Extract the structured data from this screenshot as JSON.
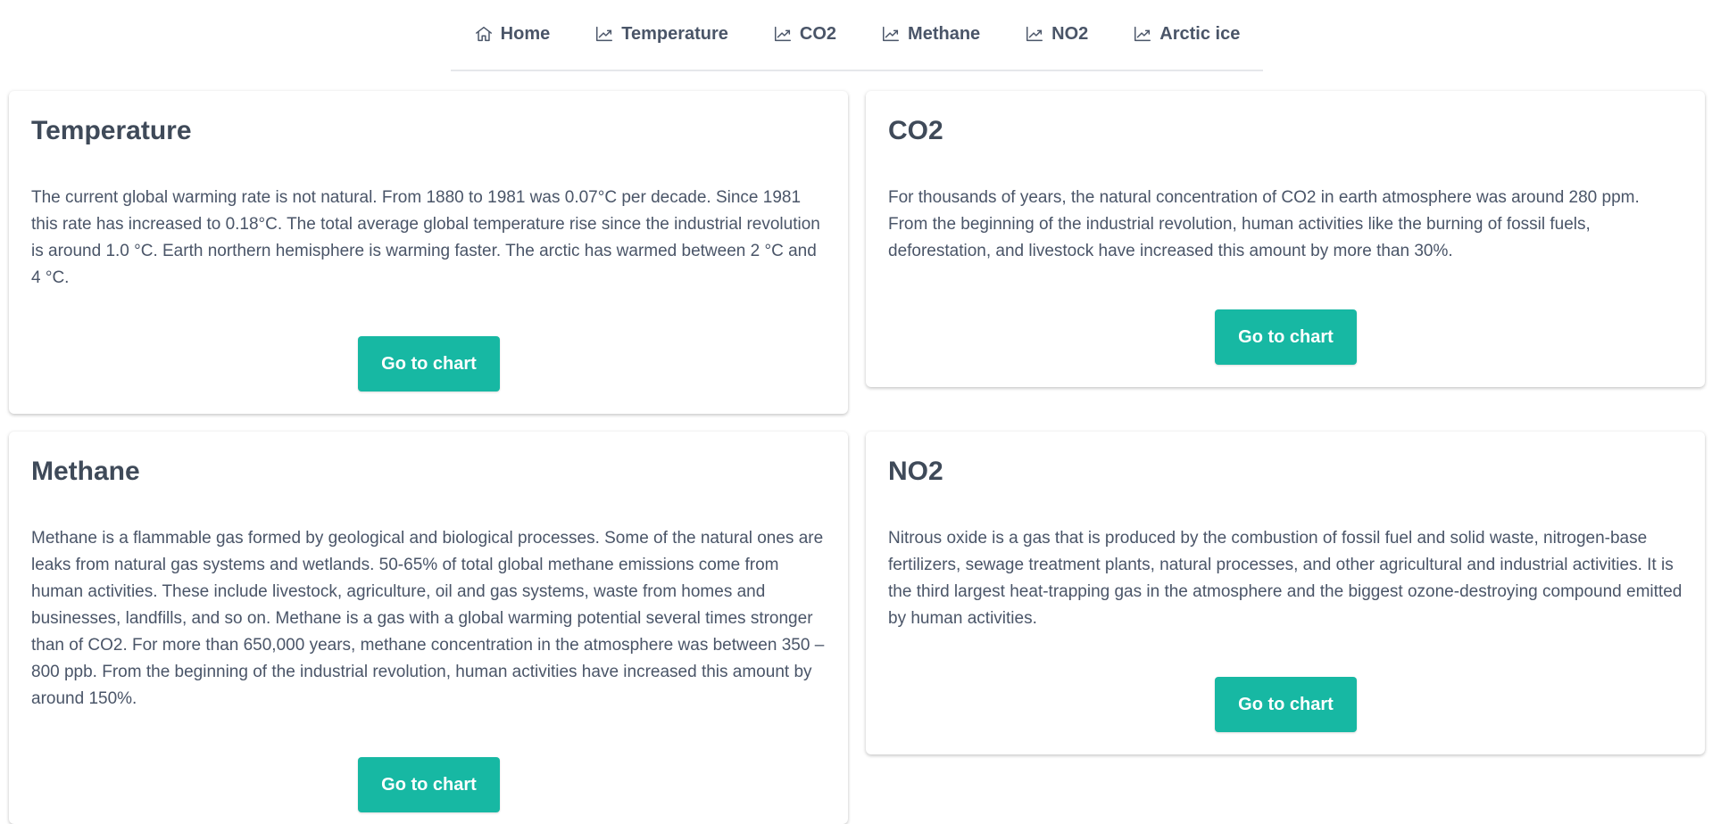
{
  "nav": {
    "items": [
      {
        "label": "Home",
        "icon": "home-icon"
      },
      {
        "label": "Temperature",
        "icon": "chart-line-icon"
      },
      {
        "label": "CO2",
        "icon": "chart-line-icon"
      },
      {
        "label": "Methane",
        "icon": "chart-line-icon"
      },
      {
        "label": "NO2",
        "icon": "chart-line-icon"
      },
      {
        "label": "Arctic ice",
        "icon": "chart-line-icon"
      }
    ]
  },
  "cards": {
    "temperature": {
      "title": "Temperature",
      "text": "The current global warming rate is not natural. From 1880 to 1981 was 0.07°C per decade. Since 1981 this rate has increased to 0.18°C. The total average global temperature rise since the industrial revolution is around 1.0 °C. Earth northern hemisphere is warming faster. The arctic has warmed between 2 °C and 4 °C.",
      "button": "Go to chart"
    },
    "co2": {
      "title": "CO2",
      "text": "For thousands of years, the natural concentration of CO2 in earth atmosphere was around 280 ppm. From the beginning of the industrial revolution, human activities like the burning of fossil fuels, deforestation, and livestock have increased this amount by more than 30%.",
      "button": "Go to chart"
    },
    "methane": {
      "title": "Methane",
      "text": "Methane is a flammable gas formed by geological and biological processes. Some of the natural ones are leaks from natural gas systems and wetlands. 50-65% of total global methane emissions come from human activities. These include livestock, agriculture, oil and gas systems, waste from homes and businesses, landfills, and so on. Methane is a gas with a global warming potential several times stronger than of CO2. For more than 650,000 years, methane concentration in the atmosphere was between 350 – 800 ppb. From the beginning of the industrial revolution, human activities have increased this amount by around 150%.",
      "button": "Go to chart"
    },
    "no2": {
      "title": "NO2",
      "text": "Nitrous oxide is a gas that is produced by the combustion of fossil fuel and solid waste, nitrogen-base fertilizers, sewage treatment plants, natural processes, and other agricultural and industrial activities. It is the third largest heat-trapping gas in the atmosphere and the biggest ozone-destroying compound emitted by human activities.",
      "button": "Go to chart"
    }
  },
  "colors": {
    "accent": "#17b8a3",
    "text": "#4a5568",
    "heading": "#3f4a59"
  }
}
